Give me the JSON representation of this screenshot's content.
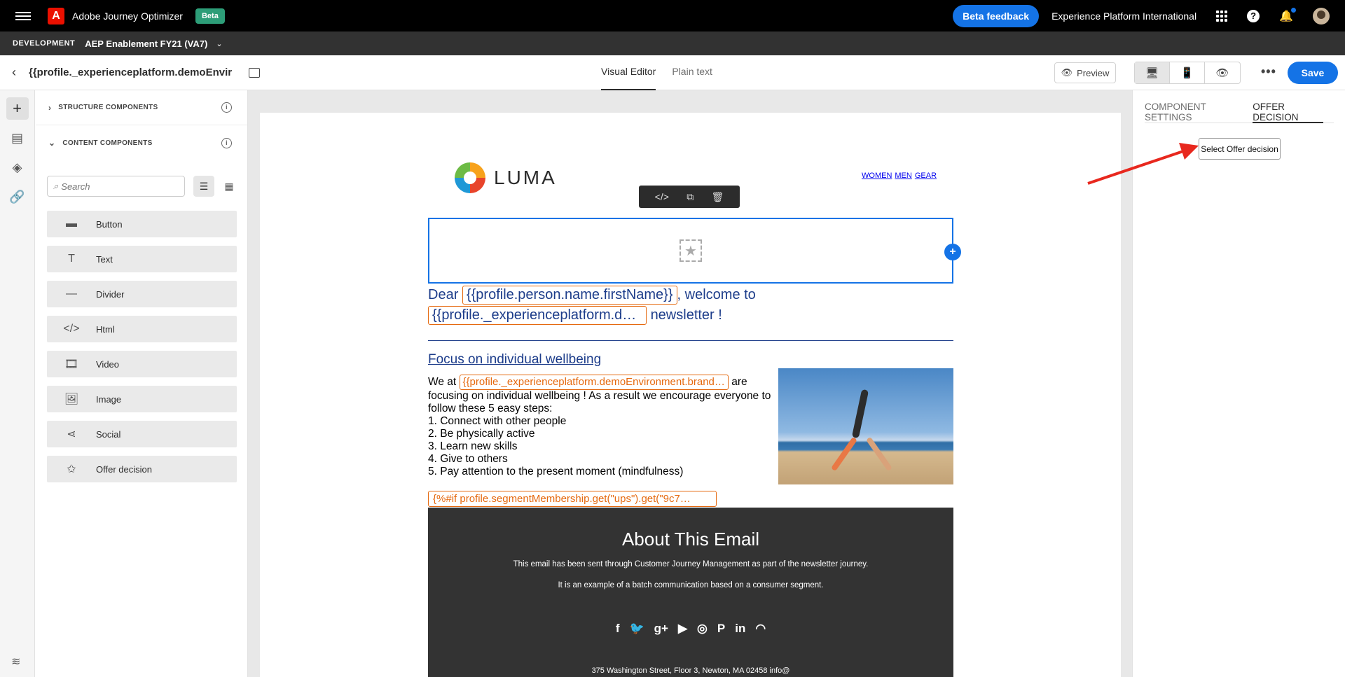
{
  "topbar": {
    "app_name": "Adobe Journey Optimizer",
    "beta_badge": "Beta",
    "beta_feedback": "Beta feedback",
    "org_name": "Experience Platform International"
  },
  "sandbox": {
    "environment": "DEVELOPMENT",
    "name": "AEP Enablement FY21 (VA7)"
  },
  "editor": {
    "title": "{{profile._experienceplatform.demoEnvir…",
    "tabs": [
      {
        "label": "Visual Editor",
        "active": true
      },
      {
        "label": "Plain text",
        "active": false
      }
    ],
    "preview_label": "Preview",
    "save_label": "Save"
  },
  "components_panel": {
    "structure_label": "STRUCTURE COMPONENTS",
    "content_label": "CONTENT COMPONENTS",
    "search_placeholder": "Search",
    "items": [
      {
        "label": "Button",
        "icon": "button-icon"
      },
      {
        "label": "Text",
        "icon": "text-icon"
      },
      {
        "label": "Divider",
        "icon": "divider-icon"
      },
      {
        "label": "Html",
        "icon": "html-icon"
      },
      {
        "label": "Video",
        "icon": "video-icon"
      },
      {
        "label": "Image",
        "icon": "image-icon"
      },
      {
        "label": "Social",
        "icon": "social-icon"
      },
      {
        "label": "Offer decision",
        "icon": "offer-decision-icon"
      }
    ]
  },
  "email": {
    "logo_text": "LUMA",
    "nav": [
      "WOMEN",
      "MEN",
      "GEAR"
    ],
    "greeting_prefix": "Dear",
    "first_name_token": "{{profile.person.name.firstName}}",
    "greeting_mid": ", welcome to",
    "brand_token": "{{profile._experienceplatform.d…",
    "greeting_suffix": "newsletter !",
    "focus_title": "Focus on individual wellbeing ",
    "body_prefix": "We at",
    "body_token": "{{profile._experienceplatform.demoEnvironment.brand…",
    "body_after_token": "are focusing on individual wellbeing ! As a result we encourage everyone to follow these 5 easy steps:",
    "steps": [
      "1. Connect with other people",
      "2. Be physically active",
      "3. Learn new skills",
      "4. Give to others",
      "5. Pay attention to the present moment (mindfulness)"
    ],
    "segment_token": "{%#if profile.segmentMembership.get(\"ups\").get(\"9c7…",
    "footer_title": "About This Email",
    "footer_line1": "This email has been sent through Customer Journey Management as part of the newsletter journey.",
    "footer_line2": "It is an example of a batch communication based on a consumer segment.",
    "address": "375 Washington Street, Floor 3, Newton, MA 02458 info@"
  },
  "right_panel": {
    "tabs": [
      {
        "label": "COMPONENT SETTINGS",
        "active": false
      },
      {
        "label": "OFFER DECISION",
        "active": true
      }
    ],
    "select_offer_label": "Select Offer decision"
  },
  "colors": {
    "accent": "#1473e6",
    "token_border": "#e5690f",
    "annotation_arrow": "#e8281e"
  }
}
